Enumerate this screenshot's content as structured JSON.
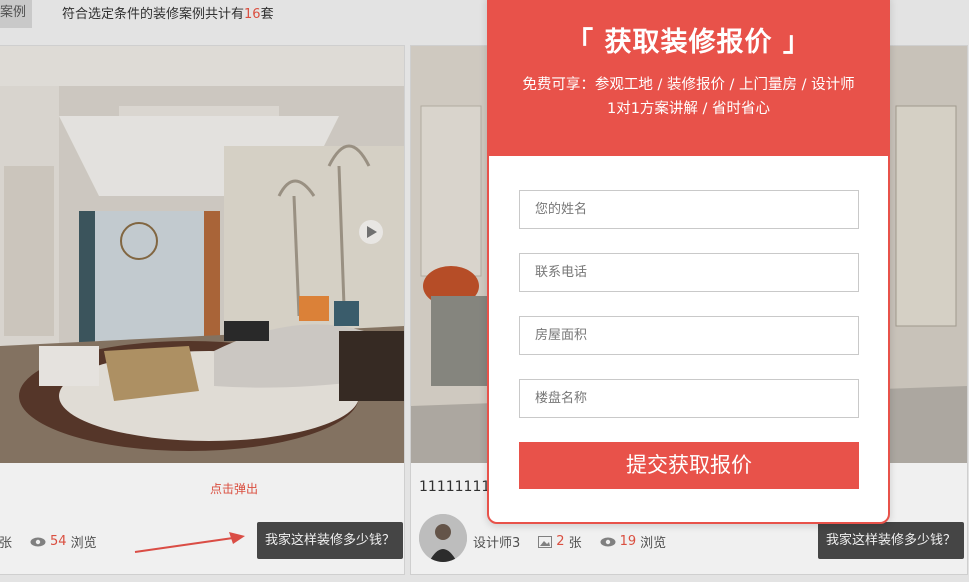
{
  "filter": {
    "tab_label": "案例",
    "result_prefix": "符合选定条件的装修案例共计有",
    "result_count": "16",
    "result_suffix": "套"
  },
  "cards": [
    {
      "title": "",
      "author": "",
      "images_label": "张",
      "views": "54",
      "views_label": "浏览",
      "price_button": "我家这样装修多少钱？"
    },
    {
      "title": "1111111111",
      "author": "设计师3",
      "images": "2",
      "images_label": "张",
      "views": "19",
      "views_label": "浏览",
      "price_button": "我家这样装修多少钱？"
    }
  ],
  "popup_hint": "点击弹出",
  "modal": {
    "title": "「 获取装修报价 」",
    "subtitle_line1": "免费可享：参观工地 / 装修报价 / 上门量房 / 设计师",
    "subtitle_line2": "1对1方案讲解 / 省时省心",
    "name_placeholder": "您的姓名",
    "phone_placeholder": "联系电话",
    "area_placeholder": "房屋面积",
    "building_placeholder": "楼盘名称",
    "submit_label": "提交获取报价"
  },
  "colors": {
    "accent": "#e8524a",
    "dark_button": "#4a4a4a",
    "count_red": "#e85444"
  },
  "icons": [
    "eye-icon",
    "image-icon",
    "arrow-icon",
    "play-icon"
  ]
}
